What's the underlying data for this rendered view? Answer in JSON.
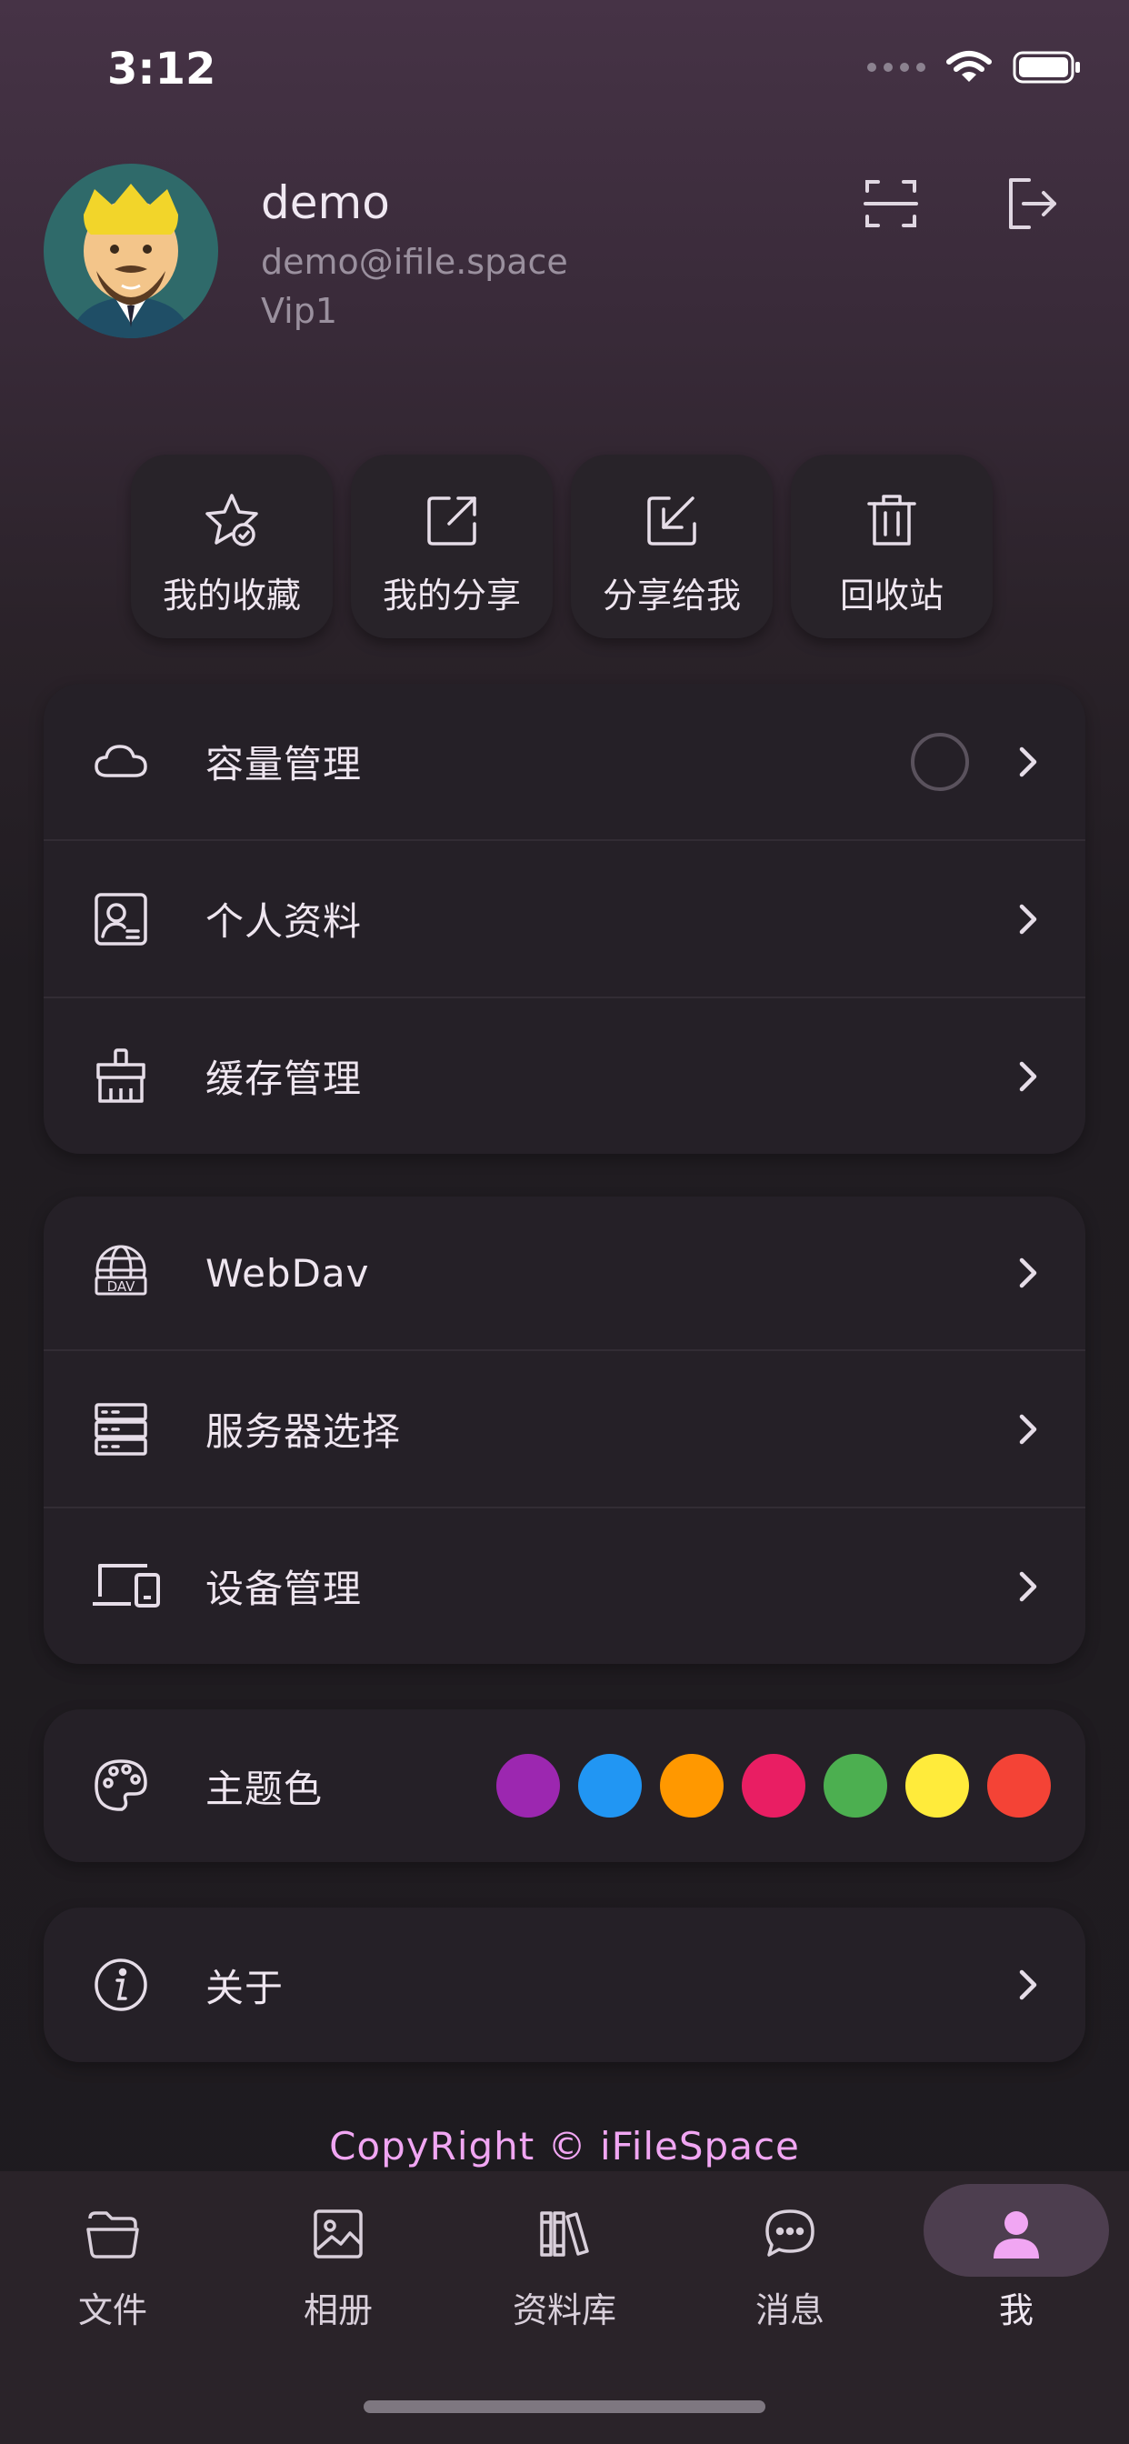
{
  "status_bar": {
    "time": "3:12"
  },
  "profile": {
    "username": "demo",
    "email": "demo@ifile.space",
    "level": "Vip1",
    "scan_icon": "scan-icon",
    "logout_icon": "logout-icon"
  },
  "quick_actions": [
    {
      "label": "我的收藏",
      "icon": "favorite-star-icon"
    },
    {
      "label": "我的分享",
      "icon": "share-out-icon"
    },
    {
      "label": "分享给我",
      "icon": "share-in-icon"
    },
    {
      "label": "回收站",
      "icon": "trash-icon"
    }
  ],
  "account_menu": [
    {
      "label": "容量管理",
      "icon": "cloud-icon"
    },
    {
      "label": "个人资料",
      "icon": "profile-card-icon"
    },
    {
      "label": "缓存管理",
      "icon": "broom-icon"
    }
  ],
  "service_menu": [
    {
      "label": "WebDav",
      "icon": "webdav-globe-icon"
    },
    {
      "label": "服务器选择",
      "icon": "server-icon"
    },
    {
      "label": "设备管理",
      "icon": "devices-icon"
    }
  ],
  "theme": {
    "label": "主题色",
    "icon": "palette-icon",
    "colors": [
      "#9c27b0",
      "#2196f3",
      "#ff9800",
      "#e91e63",
      "#4caf50",
      "#ffeb3b",
      "#f44336"
    ]
  },
  "about": {
    "label": "关于",
    "icon": "info-icon"
  },
  "footer": {
    "copyright": "CopyRight © iFileSpace"
  },
  "bottom_nav": {
    "active": "我",
    "items": [
      {
        "label": "文件",
        "icon": "folder-icon"
      },
      {
        "label": "相册",
        "icon": "photo-icon"
      },
      {
        "label": "资料库",
        "icon": "library-icon"
      },
      {
        "label": "消息",
        "icon": "chat-icon"
      },
      {
        "label": "我",
        "icon": "person-icon"
      }
    ]
  },
  "accent_color": "#f1a6f3"
}
